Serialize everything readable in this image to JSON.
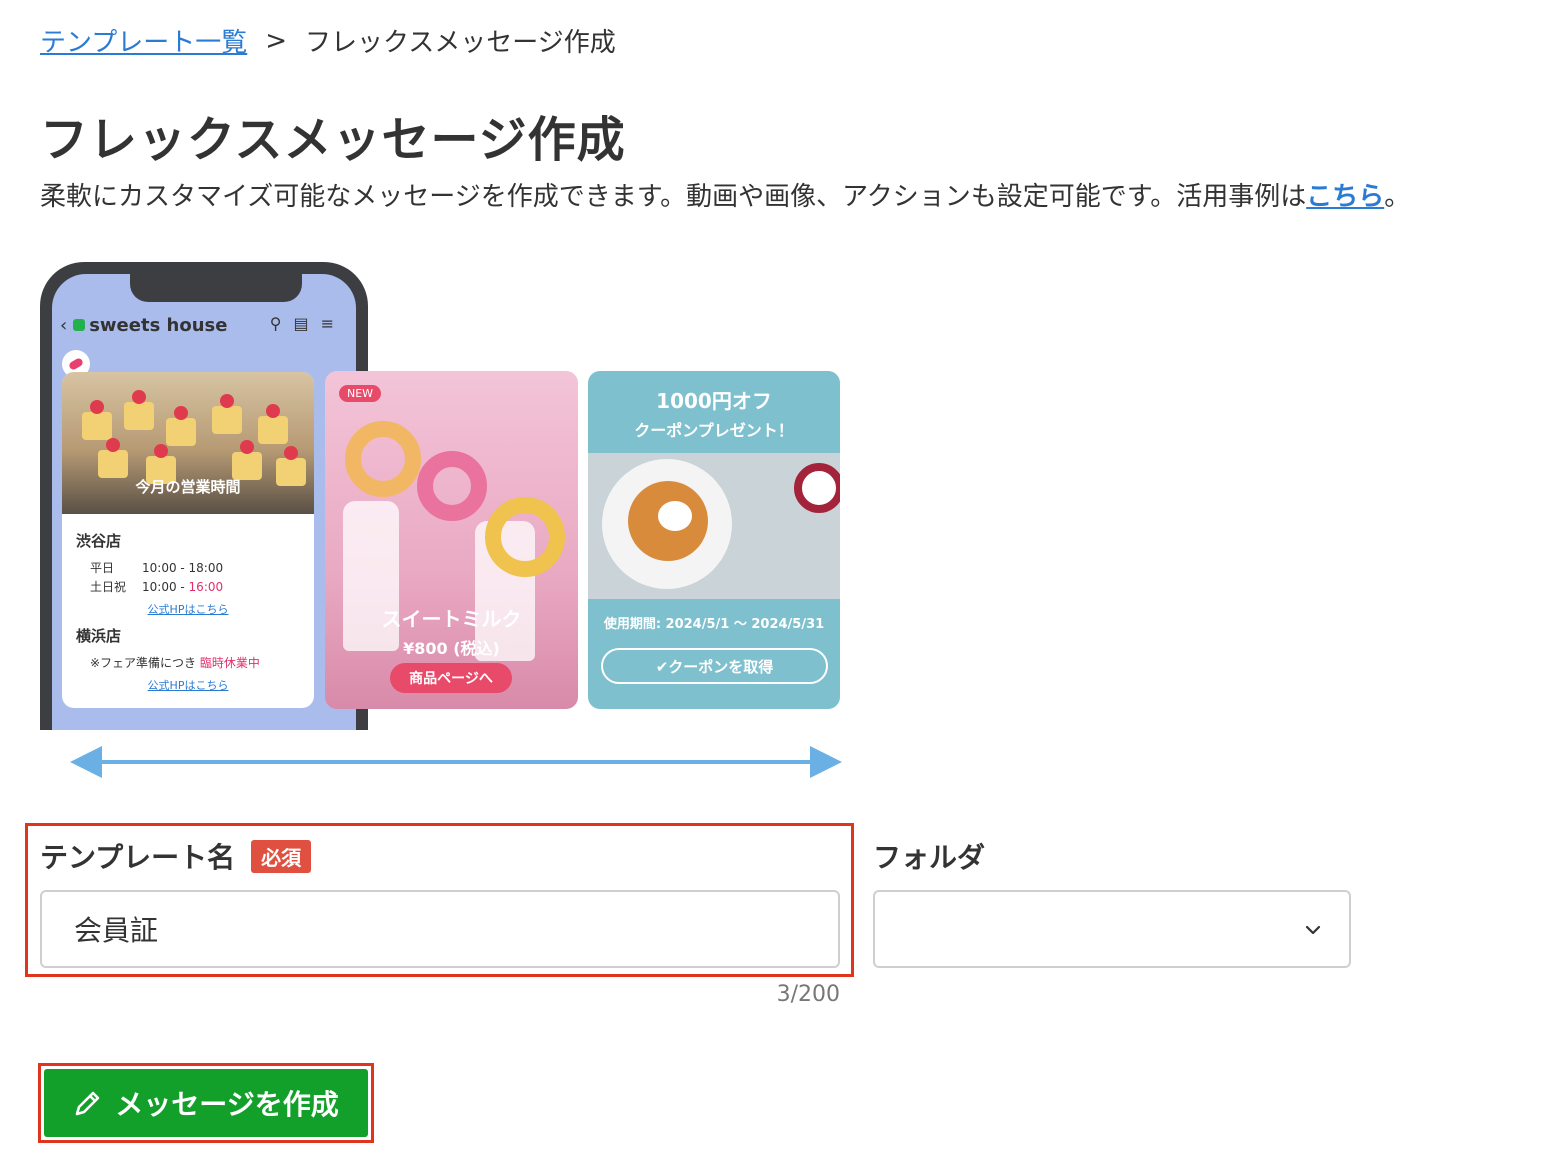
{
  "breadcrumb": {
    "parent": "テンプレート一覧",
    "separator": ">",
    "current": "フレックスメッセージ作成"
  },
  "page": {
    "title": "フレックスメッセージ作成",
    "description_prefix": "柔軟にカスタマイズ可能なメッセージを作成できます。動画や画像、アクションも設定可能です。活用事例は",
    "description_link": "こちら",
    "description_suffix": "。"
  },
  "preview": {
    "account_name": "sweets house",
    "card1": {
      "caption": "今月の営業時間",
      "store1": "渋谷店",
      "weekday_label": "平日",
      "weekday_hours": "10:00 - 18:00",
      "holiday_label": "土日祝",
      "holiday_hours_start": "10:00 - ",
      "holiday_hours_end": "16:00",
      "link1": "公式HPはこちら",
      "store2": "横浜店",
      "notice_prefix": "※フェア準備につき ",
      "notice_highlight": "臨時休業中",
      "link2": "公式HPはこちら"
    },
    "card2": {
      "badge": "NEW",
      "title": "スイートミルク",
      "price": "¥800 (税込)",
      "button": "商品ページへ"
    },
    "card3": {
      "title": "1000円オフ",
      "subtitle": "クーポンプレゼント！",
      "period": "使用期間: 2024/5/1 ～ 2024/5/31",
      "button": "✔クーポンを取得"
    }
  },
  "form": {
    "template_name_label": "テンプレート名",
    "required_badge": "必須",
    "template_name_value": "会員証",
    "char_count": "3/200",
    "folder_label": "フォルダ",
    "folder_value": ""
  },
  "actions": {
    "create_label": "メッセージを作成"
  },
  "colors": {
    "link": "#2a7bd4",
    "primary_button": "#12a02a",
    "required": "#e05040",
    "highlight_border": "#e0341c",
    "arrow": "#6bb0e4"
  }
}
